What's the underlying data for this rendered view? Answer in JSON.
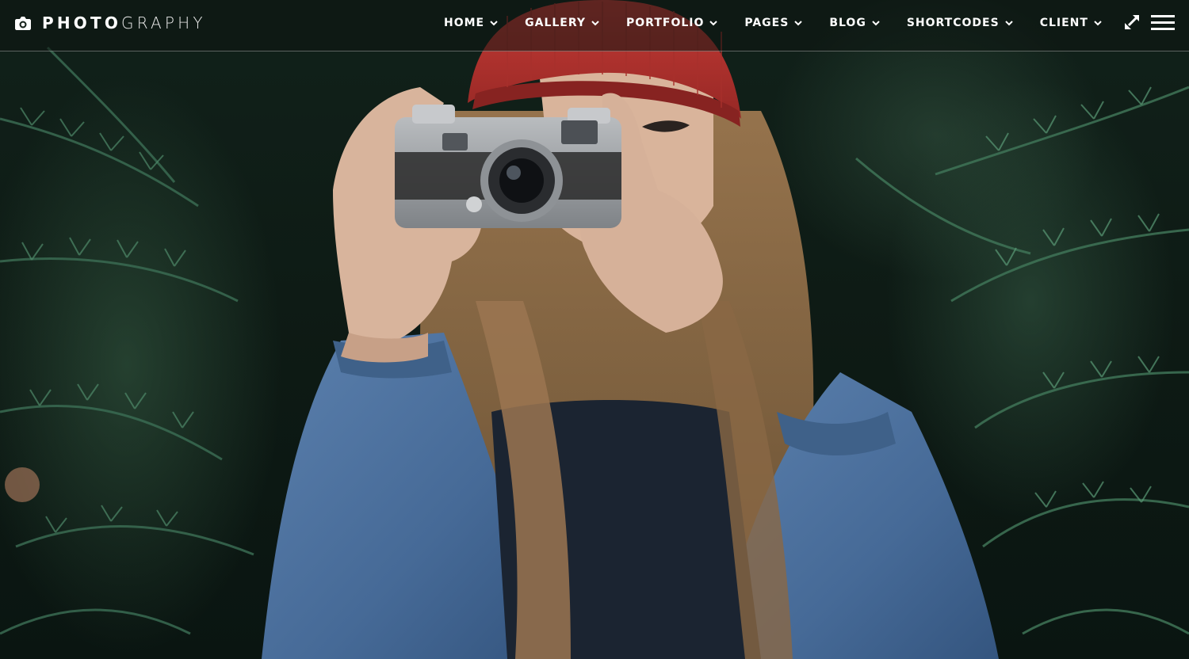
{
  "brand": {
    "name_bold": "PHOTO",
    "name_light": "GRAPHY",
    "icon": "camera-icon"
  },
  "nav": {
    "items": [
      {
        "label": "HOME",
        "icon": "chevron-down-icon"
      },
      {
        "label": "GALLERY",
        "icon": "chevron-down-icon"
      },
      {
        "label": "PORTFOLIO",
        "icon": "chevron-down-icon"
      },
      {
        "label": "PAGES",
        "icon": "chevron-down-icon"
      },
      {
        "label": "BLOG",
        "icon": "chevron-down-icon"
      },
      {
        "label": "SHORTCODES",
        "icon": "chevron-down-icon"
      },
      {
        "label": "CLIENT",
        "icon": "chevron-down-icon"
      }
    ]
  },
  "actions": {
    "fullscreen_icon": "expand-icon",
    "menu_icon": "hamburger-menu-icon"
  },
  "colors": {
    "nav_text": "#ffffff",
    "header_divider": "#ffffff",
    "hat": "#b8322e",
    "jacket": "#4a6c9a",
    "foliage": "#2e5a45"
  }
}
